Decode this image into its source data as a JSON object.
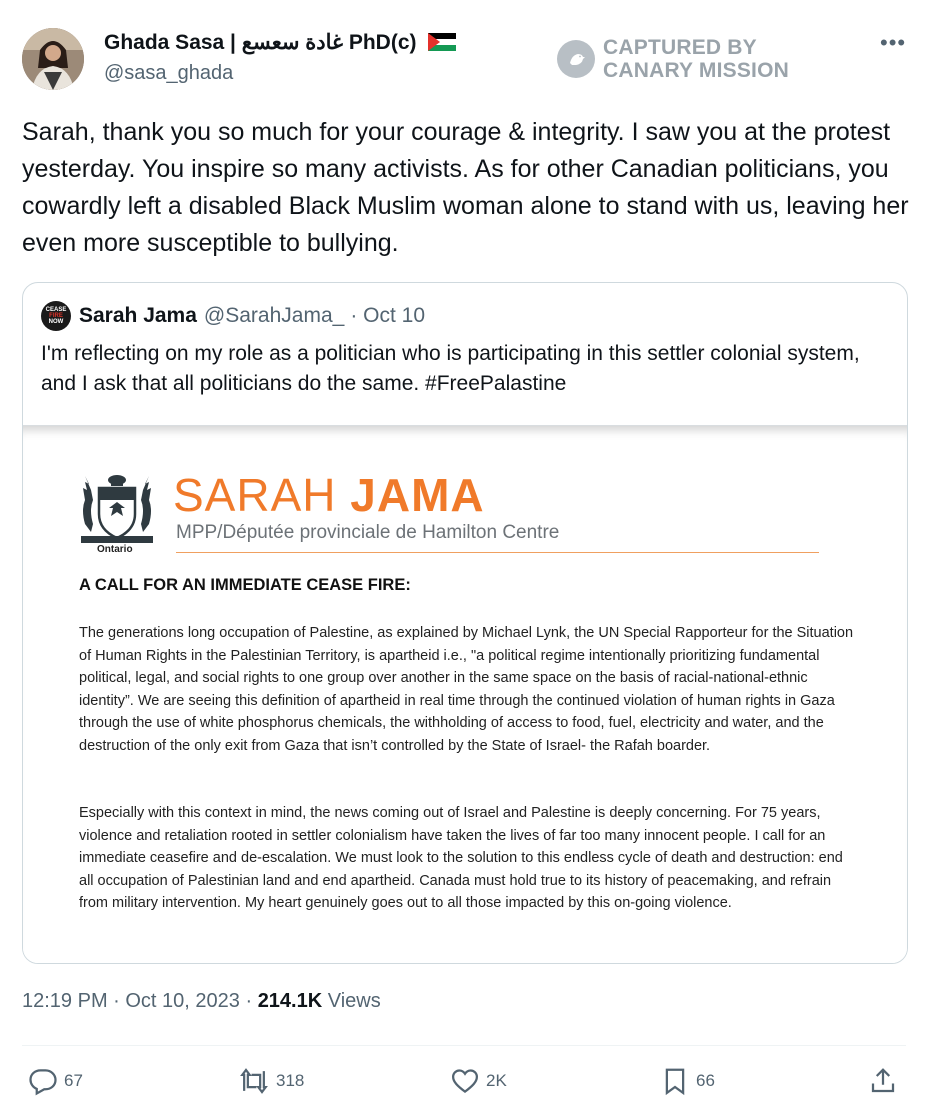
{
  "author": {
    "name": "Ghada Sasa | غادة سعسع PhD(c)",
    "handle": "@sasa_ghada"
  },
  "watermark": {
    "line1": "CAPTURED BY",
    "line2": "CANARY MISSION"
  },
  "more_label": "•••",
  "tweet_text": "Sarah, thank you so much for your courage & integrity. I saw you at the protest yesterday. You inspire so many activists. As for other Canadian politicians, you cowardly left a disabled Black Muslim woman alone to stand with us, leaving her even more susceptible to bullying.",
  "quote": {
    "avatar_text": [
      "CEASE",
      "FIRE",
      "NOW"
    ],
    "name": "Sarah Jama",
    "handle": "@SarahJama_",
    "date": "· Oct 10",
    "text": "I'm reflecting on my role as a politician who is participating in this settler colonial system, and I ask that all politicians do the same. #FreePalastine",
    "document": {
      "crest_label": "Ontario",
      "name_first": "SARAH ",
      "name_last": "JAMA",
      "subtitle": "MPP/Députée provinciale de Hamilton Centre",
      "heading": "A CALL FOR AN IMMEDIATE CEASE FIRE:",
      "paragraph1": "The generations long occupation of Palestine, as explained by Michael Lynk, the UN Special Rapporteur for the Situation of Human Rights in the Palestinian Territory, is apartheid i.e., \"a political regime intentionally prioritizing fundamental political, legal, and social rights to one group over another in the same space on the basis of racial-national-ethnic identity”. We are seeing this definition of apartheid in real time through the continued violation of human rights in Gaza through the use of white phosphorus chemicals, the withholding of access to food, fuel, electricity and water, and the destruction of the only exit from Gaza that isn’t controlled by the State of Israel- the Rafah boarder.",
      "paragraph2": "Especially with this context in mind, the news coming out of Israel and Palestine is deeply concerning. For 75 years, violence and retaliation rooted in settler colonialism have taken the lives of far too many innocent people. I call for an immediate ceasefire and de-escalation. We must look to the solution to this endless cycle of death and destruction: end all occupation of Palestinian land and end apartheid. Canada must hold true to its history of peacemaking, and refrain from military intervention. My heart genuinely goes out to all those impacted by this on-going violence."
    }
  },
  "meta": {
    "time": "12:19 PM · Oct 10, 2023 · ",
    "views_count": "214.1K",
    "views_label": " Views"
  },
  "actions": {
    "replies": "67",
    "reposts": "318",
    "likes": "2K",
    "bookmarks": "66"
  },
  "colors": {
    "accent_orange": "#f07a2a",
    "secondary_text": "#536471"
  }
}
